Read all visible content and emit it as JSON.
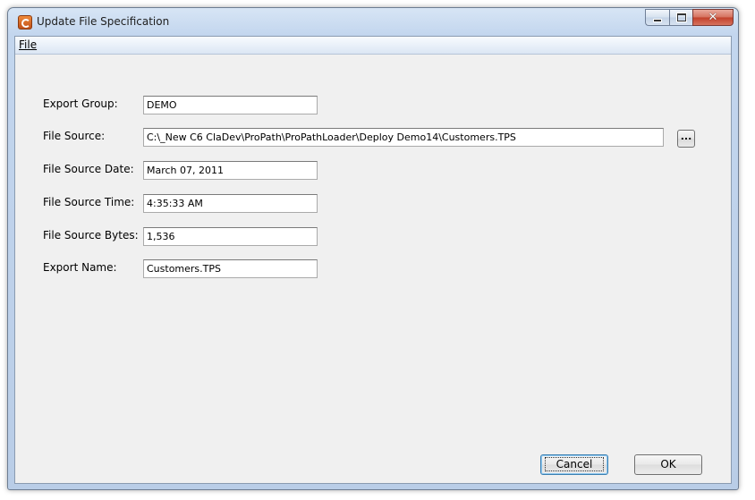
{
  "window": {
    "title": "Update File Specification",
    "app_icon": "app-icon"
  },
  "caption_buttons": {
    "minimize": "minimize-icon",
    "maximize": "maximize-icon",
    "close": "✕"
  },
  "menubar": {
    "file": "File"
  },
  "form": {
    "export_group": {
      "label": "Export Group:",
      "value": "DEMO"
    },
    "file_source": {
      "label": "File Source:",
      "value": "C:\\_New C6 ClaDev\\ProPath\\ProPathLoader\\Deploy Demo14\\Customers.TPS",
      "browse_label": "..."
    },
    "file_source_date": {
      "label": "File Source Date:",
      "value": "March 07, 2011"
    },
    "file_source_time": {
      "label": "File Source Time:",
      "value": "4:35:33 AM"
    },
    "file_source_bytes": {
      "label": "File Source Bytes:",
      "value": "1,536"
    },
    "export_name": {
      "label": "Export Name:",
      "value": "Customers.TPS"
    }
  },
  "buttons": {
    "cancel": "Cancel",
    "ok": "OK"
  }
}
